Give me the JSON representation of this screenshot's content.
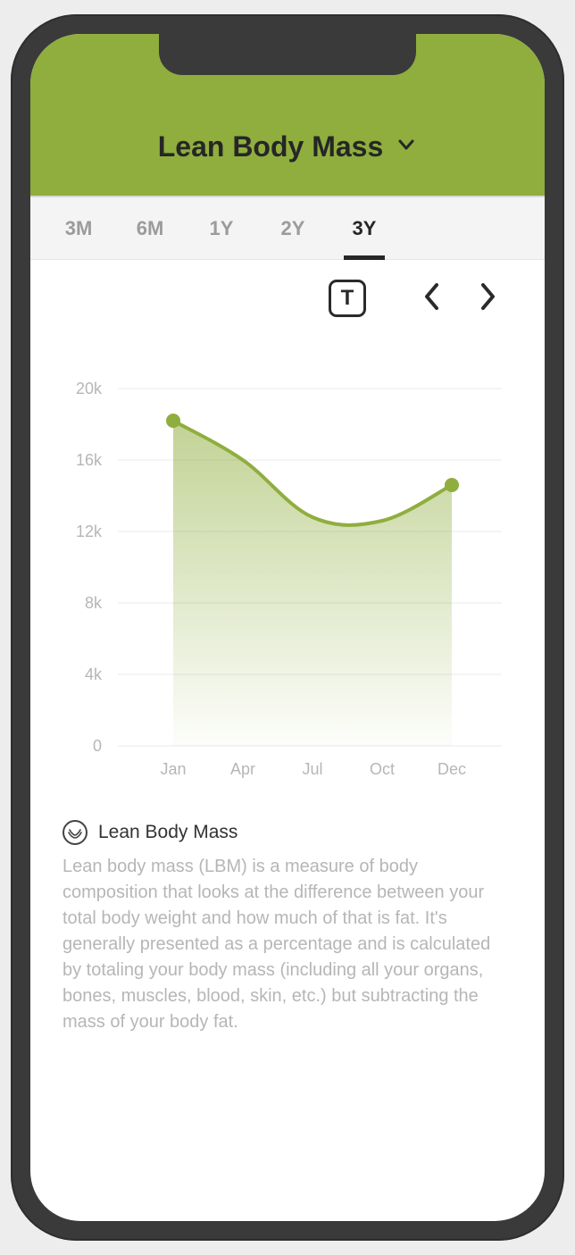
{
  "header": {
    "title": "Lean Body Mass"
  },
  "tabs": {
    "items": [
      "3M",
      "6M",
      "1Y",
      "2Y",
      "3Y"
    ],
    "active_index": 4
  },
  "toolbar": {
    "today_label": "T"
  },
  "chart_data": {
    "type": "area",
    "x": [
      "Jan",
      "Apr",
      "Jul",
      "Oct",
      "Dec"
    ],
    "values": [
      18200,
      16000,
      12800,
      12600,
      14600
    ],
    "ylim": [
      0,
      20000
    ],
    "y_ticks": [
      "20k",
      "16k",
      "12k",
      "8k",
      "4k",
      "0"
    ],
    "xlabel": "",
    "ylabel": "",
    "title": "",
    "color": "#8fae3e",
    "endpoints_visible": [
      0,
      4
    ]
  },
  "info": {
    "title": "Lean Body Mass",
    "text": "Lean body mass (LBM) is a measure of body composition that looks at the difference between your total body weight and how much of that is fat. It's generally presented as a percentage and is calculated by totaling your body mass (including all your organs, bones, muscles, blood, skin, etc.) but subtracting the mass of your body fat."
  }
}
